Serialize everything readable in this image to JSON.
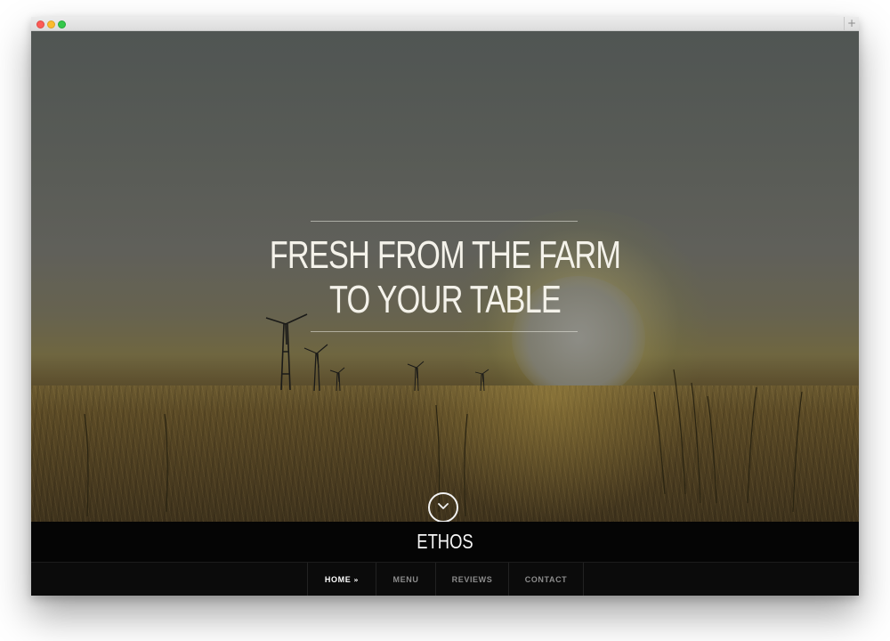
{
  "window": {
    "controls": [
      "close",
      "minimize",
      "zoom"
    ],
    "new_tab_symbol": "+"
  },
  "hero": {
    "headline_line1": "FRESH FROM THE FARM",
    "headline_line2": "TO YOUR TABLE",
    "scroll_icon": "chevron-down-icon"
  },
  "site": {
    "brand": "ETHOS"
  },
  "nav": {
    "items": [
      {
        "label": "HOME",
        "active": true,
        "icon": "double-chevron-down-icon",
        "icon_glyph": "»"
      },
      {
        "label": "MENU",
        "active": false
      },
      {
        "label": "REVIEWS",
        "active": false
      },
      {
        "label": "CONTACT",
        "active": false
      }
    ]
  },
  "colors": {
    "nav_bg": "#0b0b0b",
    "brand_bar_bg": "#050505",
    "nav_text": "#8c8c8c",
    "nav_active_text": "#ffffff",
    "headline_text": "#f4f2ea"
  }
}
